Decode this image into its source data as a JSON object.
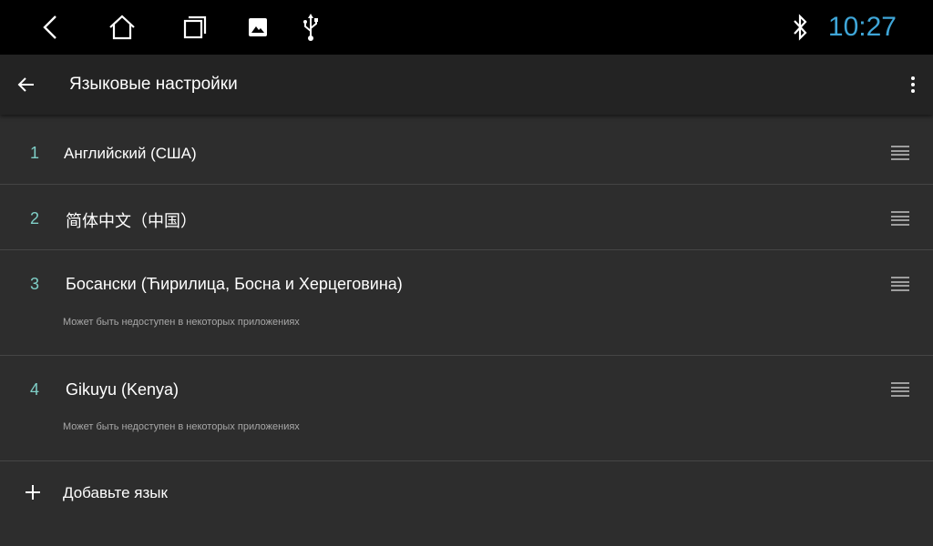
{
  "status_bar": {
    "icons": [
      "back-nav-icon",
      "home-icon",
      "recent-apps-icon",
      "gallery-icon",
      "usb-icon",
      "bluetooth-icon"
    ],
    "clock": "10:27",
    "clock_color": "#3fa6d8"
  },
  "app_bar": {
    "title": "Языковые настройки"
  },
  "languages": [
    {
      "index": "1",
      "name": "Английский (США)",
      "note": ""
    },
    {
      "index": "2",
      "name": "简体中文（中国）",
      "note": ""
    },
    {
      "index": "3",
      "name": "Босански (Ћирилица, Босна и Херцеговина)",
      "note": "Может быть недоступен в некоторых приложениях"
    },
    {
      "index": "4",
      "name": "Gikuyu (Kenya)",
      "note": "Может быть недоступен в некоторых приложениях"
    }
  ],
  "add_language": {
    "label": "Добавьте язык"
  },
  "colors": {
    "background": "#2d2d2d",
    "app_bar": "#232323",
    "index_accent": "#7fcfc7"
  }
}
